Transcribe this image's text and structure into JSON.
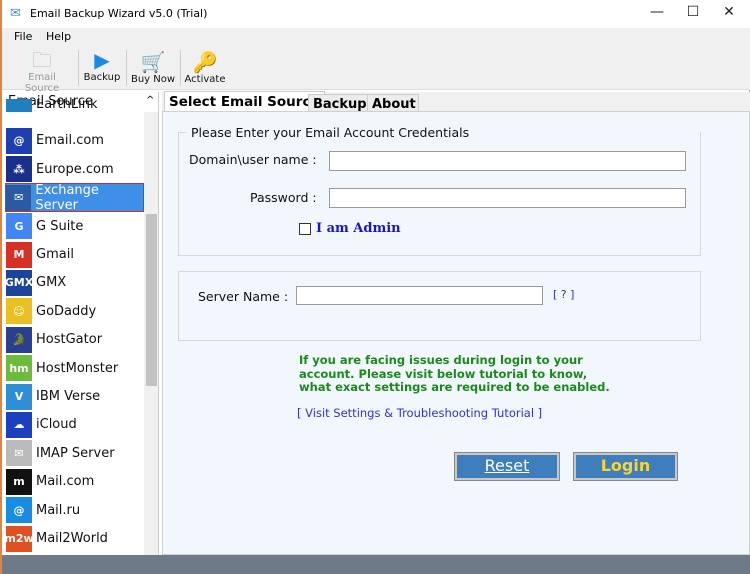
{
  "window": {
    "title": "Email Backup Wizard v5.0 (Trial)",
    "minimize": "—",
    "maximize": "☐",
    "close": "✕"
  },
  "menu": [
    "File",
    "Help"
  ],
  "toolbar": [
    {
      "label": "Email Source",
      "icon": "folder-add-icon",
      "glyph": "🗀",
      "disabled": true
    },
    {
      "label": "Backup",
      "icon": "play-icon",
      "glyph": "▶"
    },
    {
      "label": "Buy Now",
      "icon": "cart-icon",
      "glyph": "🛒"
    },
    {
      "label": "Activate",
      "icon": "key-icon",
      "glyph": "🔑"
    }
  ],
  "sidebar": {
    "title": "Email Source",
    "scroll_up": "^",
    "items": [
      {
        "label": "EarthLink",
        "glyph": "",
        "color": "#1f7fbf"
      },
      {
        "label": "Email.com",
        "glyph": "@",
        "color": "#1d3fb0"
      },
      {
        "label": "Europe.com",
        "glyph": "⁂",
        "color": "#1a2f8a"
      },
      {
        "label": "Exchange Server",
        "glyph": "✉",
        "color": "#2a5aa0",
        "selected": true
      },
      {
        "label": "G Suite",
        "glyph": "G",
        "color": "#4285f4"
      },
      {
        "label": "Gmail",
        "glyph": "M",
        "color": "#d93025"
      },
      {
        "label": "GMX",
        "glyph": "GMX",
        "color": "#1c449b"
      },
      {
        "label": "GoDaddy",
        "glyph": "☺",
        "color": "#e8c020"
      },
      {
        "label": "HostGator",
        "glyph": "🐊",
        "color": "#2a3f90"
      },
      {
        "label": "HostMonster",
        "glyph": "hm",
        "color": "#6dbb3a"
      },
      {
        "label": "IBM Verse",
        "glyph": "V",
        "color": "#2e8fd8"
      },
      {
        "label": "iCloud",
        "glyph": "☁",
        "color": "#1a3fbf"
      },
      {
        "label": "IMAP Server",
        "glyph": "✉",
        "color": "#bbbbbb"
      },
      {
        "label": "Mail.com",
        "glyph": "m",
        "color": "#111111"
      },
      {
        "label": "Mail.ru",
        "glyph": "@",
        "color": "#168de2"
      },
      {
        "label": "Mail2World",
        "glyph": "m2w",
        "color": "#e05020"
      }
    ]
  },
  "tabs": [
    "Select Email Source",
    "Backup",
    "About"
  ],
  "form": {
    "group_title": "Please Enter your Email Account Credentials",
    "user_label": "Domain\\user name :",
    "user_value": "",
    "password_label": "Password :",
    "password_value": "",
    "admin_label": "I am Admin",
    "server_label": "Server Name :",
    "server_value": "",
    "help_link": "[ ? ]",
    "notice": [
      "If you are facing issues during login to your",
      "account. Please visit below tutorial to know,",
      "what exact settings are required to be enabled."
    ],
    "tutorial_link": "[ Visit Settings & Troubleshooting Tutorial ]",
    "reset": "Reset",
    "login": "Login"
  }
}
